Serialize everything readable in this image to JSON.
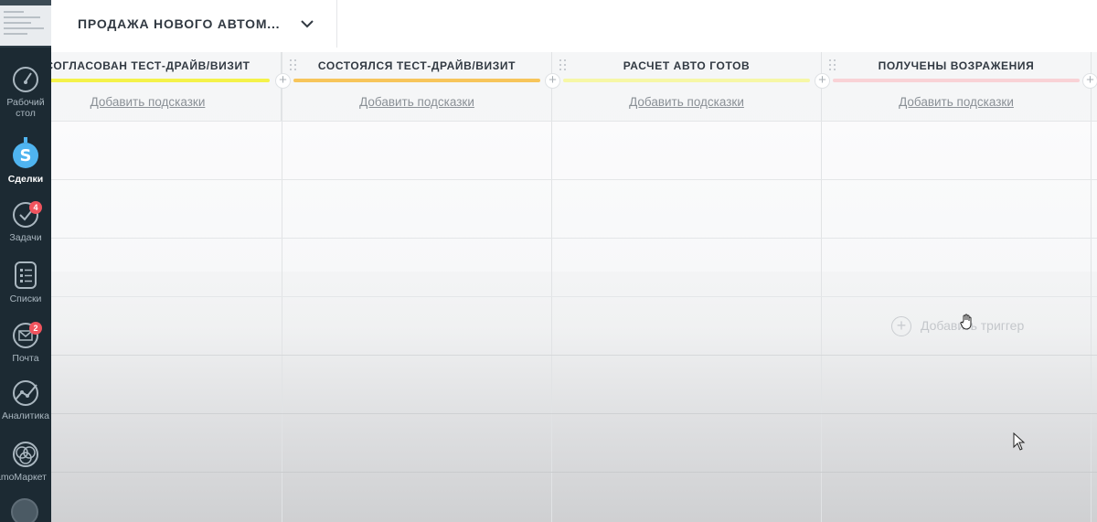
{
  "header": {
    "pipeline_title": "ПРОДАЖА НОВОГО АВТОМ..."
  },
  "sidebar": {
    "items": [
      {
        "label": "Рабочий стол",
        "icon": "dashboard-speedometer-icon"
      },
      {
        "label": "Сделки",
        "icon": "deals-dollar-icon",
        "active": true
      },
      {
        "label": "Задачи",
        "icon": "tasks-check-icon",
        "badge": "4"
      },
      {
        "label": "Списки",
        "icon": "lists-icon"
      },
      {
        "label": "Почта",
        "icon": "mail-icon",
        "badge": "2"
      },
      {
        "label": "Аналитика",
        "icon": "analytics-icon"
      },
      {
        "label": "amoМаркет",
        "icon": "market-icon"
      }
    ]
  },
  "columns": [
    {
      "title": "СОГЛАСОВАН ТЕСТ-ДРАЙВ/ВИЗИТ",
      "hint": "Добавить подсказки",
      "color": "#f4f24a"
    },
    {
      "title": "СОСТОЯЛСЯ ТЕСТ-ДРАЙВ/ВИЗИТ",
      "hint": "Добавить подсказки",
      "color": "#f7c55b"
    },
    {
      "title": "РАСЧЕТ АВТО ГОТОВ",
      "hint": "Добавить подсказки",
      "color": "#f6f7a6"
    },
    {
      "title": "ПОЛУЧЕНЫ ВОЗРАЖЕНИЯ",
      "hint": "Добавить подсказки",
      "color": "#f9d2d6"
    }
  ],
  "board": {
    "add_trigger_label": "Добавить триггер"
  },
  "colors": {
    "sidebar_bg": "#1c2a33",
    "badge": "#f0545e",
    "deals_icon": "#4fb4f0"
  }
}
